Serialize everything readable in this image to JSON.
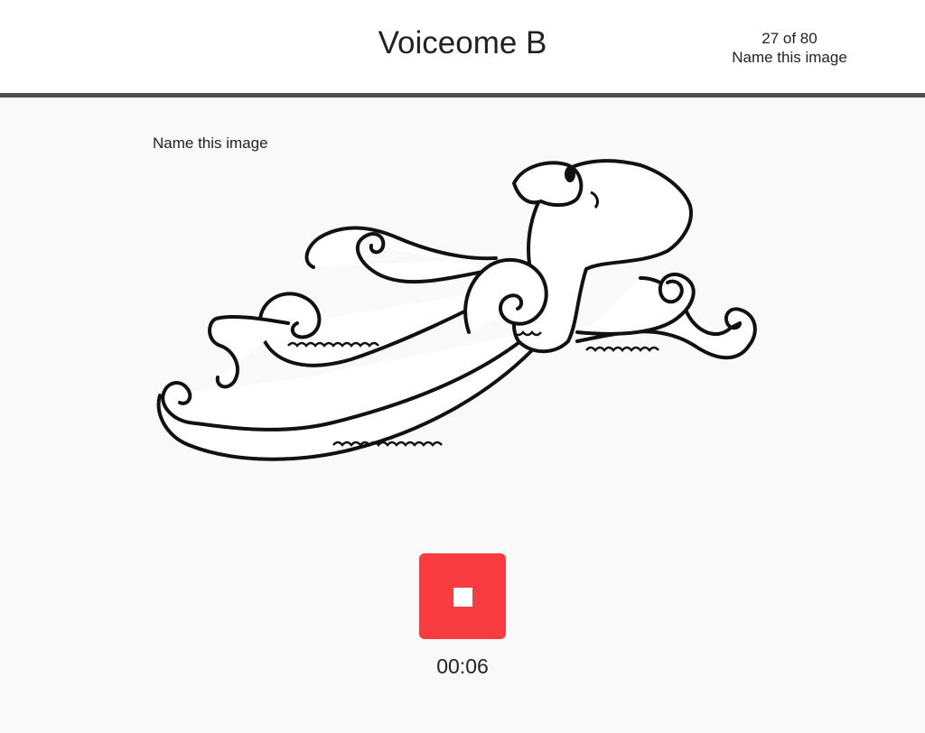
{
  "header": {
    "title": "Voiceome B",
    "progress": "27 of 80",
    "task_name": "Name this image"
  },
  "main": {
    "prompt": "Name this image",
    "image_subject": "octopus-line-drawing",
    "record": {
      "icon": "stop-icon",
      "color": "#f83c3f",
      "elapsed": "00:06"
    }
  },
  "colors": {
    "header_bg": "#ffffff",
    "header_border": "#4f4f4f",
    "page_bg": "#f9f9f9",
    "text": "#222222",
    "record_button": "#f83c3f"
  }
}
